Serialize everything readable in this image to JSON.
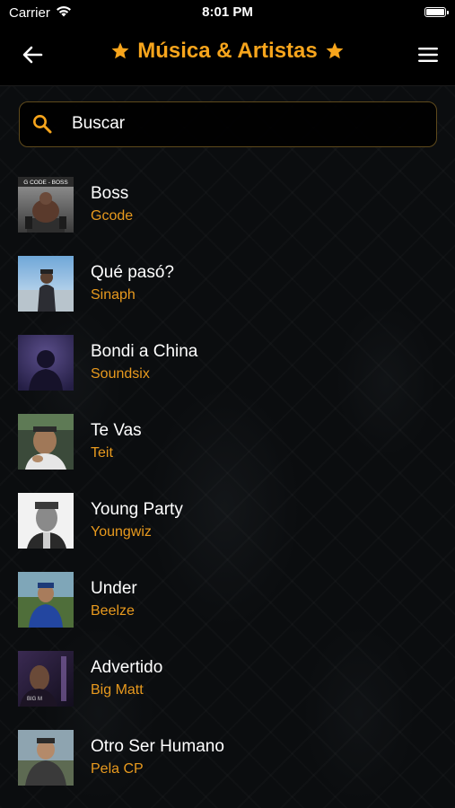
{
  "status_bar": {
    "carrier": "Carrier",
    "time": "8:01 PM"
  },
  "nav": {
    "title": "Música & Artistas",
    "accent_color": "#f7a51c",
    "back_icon": "arrow-left-icon",
    "menu_icon": "hamburger-menu-icon",
    "title_icons": [
      "star-icon",
      "star-icon"
    ]
  },
  "search": {
    "placeholder": "Buscar",
    "value": "",
    "icon": "search-icon"
  },
  "songs": [
    {
      "title": "Boss",
      "artist": "Gcode",
      "cover_caption": "G CODE - BOSS"
    },
    {
      "title": "Qué pasó?",
      "artist": "Sinaph"
    },
    {
      "title": "Bondi a China",
      "artist": "Soundsix"
    },
    {
      "title": "Te Vas",
      "artist": "Teit"
    },
    {
      "title": "Young Party",
      "artist": "Youngwiz"
    },
    {
      "title": "Under",
      "artist": "Beelze"
    },
    {
      "title": "Advertido",
      "artist": "Big Matt",
      "cover_caption": "BIG M"
    },
    {
      "title": "Otro Ser Humano",
      "artist": "Pela CP"
    }
  ]
}
